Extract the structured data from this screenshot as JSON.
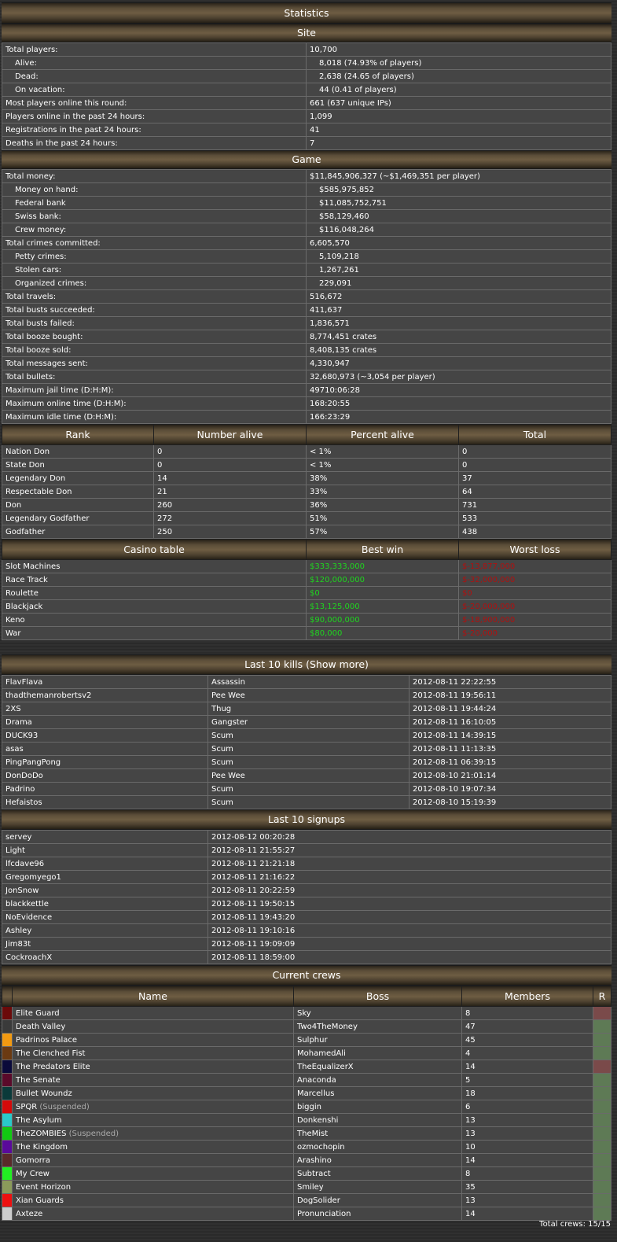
{
  "statistics": {
    "title": "Statistics",
    "site_title": "Site",
    "site": [
      {
        "label": "Total players:",
        "value": "10,700",
        "indent": false
      },
      {
        "label": "Alive:",
        "value": "8,018 (74.93% of players)",
        "indent": true
      },
      {
        "label": "Dead:",
        "value": "2,638 (24.65 of players)",
        "indent": true
      },
      {
        "label": "On vacation:",
        "value": "44 (0.41 of players)",
        "indent": true
      },
      {
        "label": "Most players online this round:",
        "value": "661 (637 unique IPs)",
        "indent": false
      },
      {
        "label": "Players online in the past 24 hours:",
        "value": "1,099",
        "indent": false
      },
      {
        "label": "Registrations in the past 24 hours:",
        "value": "41",
        "indent": false
      },
      {
        "label": "Deaths in the past 24 hours:",
        "value": "7",
        "indent": false
      }
    ],
    "game_title": "Game",
    "game": [
      {
        "label": "Total money:",
        "value": "$11,845,906,327 (~$1,469,351 per player)",
        "indent": false
      },
      {
        "label": "Money on hand:",
        "value": "$585,975,852",
        "indent": true
      },
      {
        "label": "Federal bank",
        "value": "$11,085,752,751",
        "indent": true
      },
      {
        "label": "Swiss bank:",
        "value": "$58,129,460",
        "indent": true
      },
      {
        "label": "Crew money:",
        "value": "$116,048,264",
        "indent": true
      },
      {
        "label": "Total crimes committed:",
        "value": "6,605,570",
        "indent": false
      },
      {
        "label": "Petty crimes:",
        "value": "5,109,218",
        "indent": true
      },
      {
        "label": "Stolen cars:",
        "value": "1,267,261",
        "indent": true
      },
      {
        "label": "Organized crimes:",
        "value": "229,091",
        "indent": true
      },
      {
        "label": "Total travels:",
        "value": "516,672",
        "indent": false
      },
      {
        "label": "Total busts succeeded:",
        "value": "411,637",
        "indent": false
      },
      {
        "label": "Total busts failed:",
        "value": "1,836,571",
        "indent": false
      },
      {
        "label": "Total booze bought:",
        "value": "8,774,451 crates",
        "indent": false
      },
      {
        "label": "Total booze sold:",
        "value": "8,408,135 crates",
        "indent": false
      },
      {
        "label": "Total messages sent:",
        "value": "4,330,947",
        "indent": false
      },
      {
        "label": "Total bullets:",
        "value": "32,680,973 (~3,054 per player)",
        "indent": false
      },
      {
        "label": "Maximum jail time (D:H:M):",
        "value": "49710:06:28",
        "indent": false
      },
      {
        "label": "Maximum online time (D:H:M):",
        "value": "168:20:55",
        "indent": false
      },
      {
        "label": "Maximum idle time (D:H:M):",
        "value": "166:23:29",
        "indent": false
      }
    ],
    "rank_headers": [
      "Rank",
      "Number alive",
      "Percent alive",
      "Total"
    ],
    "ranks": [
      [
        "Nation Don",
        "0",
        "< 1%",
        "0"
      ],
      [
        "State Don",
        "0",
        "< 1%",
        "0"
      ],
      [
        "Legendary Don",
        "14",
        "38%",
        "37"
      ],
      [
        "Respectable Don",
        "21",
        "33%",
        "64"
      ],
      [
        "Don",
        "260",
        "36%",
        "731"
      ],
      [
        "Legendary Godfather",
        "272",
        "51%",
        "533"
      ],
      [
        "Godfather",
        "250",
        "57%",
        "438"
      ]
    ],
    "casino_headers": [
      "Casino table",
      "Best win",
      "Worst loss"
    ],
    "casino": [
      [
        "Slot Machines",
        "$333,333,000",
        "$-13,877,000"
      ],
      [
        "Race Track",
        "$120,000,000",
        "$-32,000,000"
      ],
      [
        "Roulette",
        "$0",
        "$0"
      ],
      [
        "Blackjack",
        "$13,125,000",
        "$-20,000,000"
      ],
      [
        "Keno",
        "$90,000,000",
        "$-18,900,000"
      ],
      [
        "War",
        "$80,000",
        "$-20,000"
      ]
    ]
  },
  "kills": {
    "title": "Last 10 kills (Show more)",
    "rows": [
      [
        "FlavFlava",
        "Assassin",
        "2012-08-11 22:22:55"
      ],
      [
        "thadthemanrobertsv2",
        "Pee Wee",
        "2012-08-11 19:56:11"
      ],
      [
        "2XS",
        "Thug",
        "2012-08-11 19:44:24"
      ],
      [
        "Drama",
        "Gangster",
        "2012-08-11 16:10:05"
      ],
      [
        "DUCK93",
        "Scum",
        "2012-08-11 14:39:15"
      ],
      [
        "asas",
        "Scum",
        "2012-08-11 11:13:35"
      ],
      [
        "PingPangPong",
        "Scum",
        "2012-08-11 06:39:15"
      ],
      [
        "DonDoDo",
        "Pee Wee",
        "2012-08-10 21:01:14"
      ],
      [
        "Padrino",
        "Scum",
        "2012-08-10 19:07:34"
      ],
      [
        "Hefaistos",
        "Scum",
        "2012-08-10 15:19:39"
      ]
    ]
  },
  "signups": {
    "title": "Last 10 signups",
    "rows": [
      [
        "servey",
        "2012-08-12 00:20:28"
      ],
      [
        "Light",
        "2012-08-11 21:55:27"
      ],
      [
        "lfcdave96",
        "2012-08-11 21:21:18"
      ],
      [
        "Gregomyego1",
        "2012-08-11 21:16:22"
      ],
      [
        "JonSnow",
        "2012-08-11 20:22:59"
      ],
      [
        "blackkettle",
        "2012-08-11 19:50:15"
      ],
      [
        "NoEvidence",
        "2012-08-11 19:43:20"
      ],
      [
        "Ashley",
        "2012-08-11 19:10:16"
      ],
      [
        "Jim83t",
        "2012-08-11 19:09:09"
      ],
      [
        "CockroachX",
        "2012-08-11 18:59:00"
      ]
    ]
  },
  "crews": {
    "title": "Current crews",
    "headers": [
      "Name",
      "Boss",
      "Members",
      "R"
    ],
    "suspended_label": "(Suspended)",
    "rows": [
      {
        "color": "#6b0a0a",
        "name": "Elite Guard",
        "suspended": false,
        "boss": "Sky",
        "members": "8",
        "rcolor": "#7a4a4a"
      },
      {
        "color": "#3a3a3a",
        "name": "Death Valley",
        "suspended": false,
        "boss": "Two4TheMoney",
        "members": "47",
        "rcolor": "#5e7a55"
      },
      {
        "color": "#f29a12",
        "name": "Padrinos Palace",
        "suspended": false,
        "boss": "Sulphur",
        "members": "45",
        "rcolor": "#5e7a55"
      },
      {
        "color": "#6b3a12",
        "name": "The Clenched Fist",
        "suspended": false,
        "boss": "MohamedAli",
        "members": "4",
        "rcolor": "#5e7a55"
      },
      {
        "color": "#0a0a3a",
        "name": "The Predators Elite",
        "suspended": false,
        "boss": "TheEqualizerX",
        "members": "14",
        "rcolor": "#7a4a4a"
      },
      {
        "color": "#5a0a2a",
        "name": "The Senate",
        "suspended": false,
        "boss": "Anaconda",
        "members": "5",
        "rcolor": "#5e7a55"
      },
      {
        "color": "#0a3a3a",
        "name": "Bullet Woundz",
        "suspended": false,
        "boss": "Marcellus",
        "members": "18",
        "rcolor": "#5e7a55"
      },
      {
        "color": "#d40a0a",
        "name": "SPQR",
        "suspended": true,
        "boss": "biggin",
        "members": "6",
        "rcolor": "#5e7a55"
      },
      {
        "color": "#2ac9c9",
        "name": "The Asylum",
        "suspended": false,
        "boss": "Donkenshi",
        "members": "13",
        "rcolor": "#5e7a55"
      },
      {
        "color": "#12c912",
        "name": "TheZOMBIES",
        "suspended": true,
        "boss": "TheMist",
        "members": "13",
        "rcolor": "#5e7a55"
      },
      {
        "color": "#5a0a9a",
        "name": "The Kingdom",
        "suspended": false,
        "boss": "ozmochopin",
        "members": "10",
        "rcolor": "#5e7a55"
      },
      {
        "color": "#5a2a2a",
        "name": "Gomorra",
        "suspended": false,
        "boss": "Arashino",
        "members": "14",
        "rcolor": "#5e7a55"
      },
      {
        "color": "#22ee22",
        "name": "My Crew",
        "suspended": false,
        "boss": "Subtract",
        "members": "8",
        "rcolor": "#5e7a55"
      },
      {
        "color": "#8a9a5a",
        "name": "Event Horizon",
        "suspended": false,
        "boss": "Smiley",
        "members": "35",
        "rcolor": "#5e7a55"
      },
      {
        "color": "#ee1010",
        "name": "Xian Guards",
        "suspended": false,
        "boss": "DogSolider",
        "members": "13",
        "rcolor": "#5e7a55"
      },
      {
        "color": "#cccccc",
        "name": "Axteze",
        "suspended": false,
        "boss": "Pronunciation",
        "members": "14",
        "rcolor": "#5e7a55"
      }
    ],
    "total_label": "Total crews: 15/15"
  }
}
